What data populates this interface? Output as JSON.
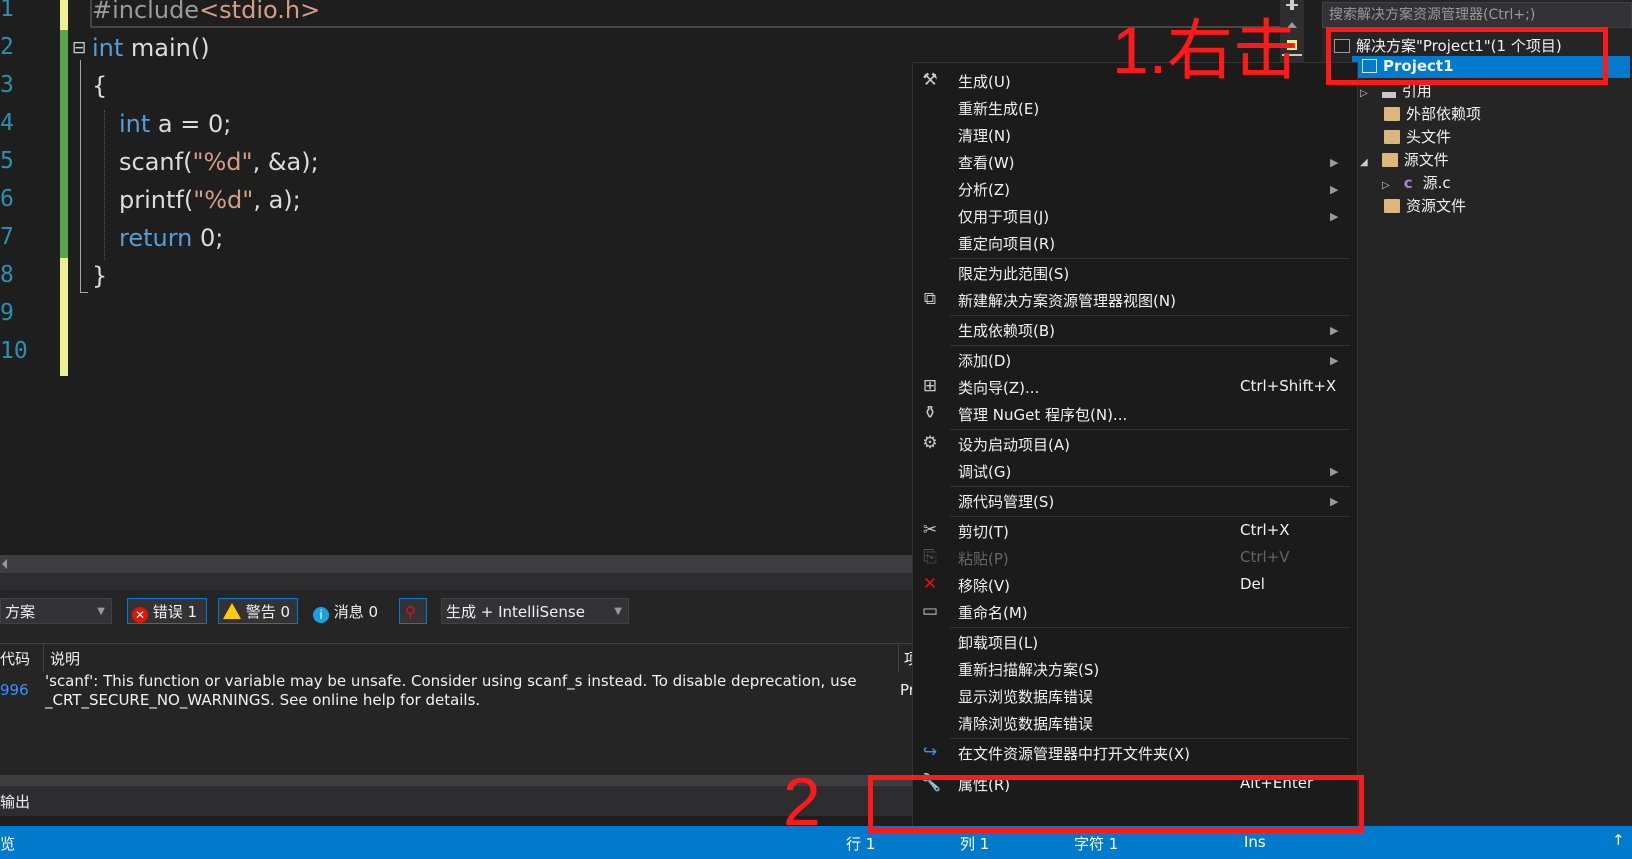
{
  "editor": {
    "line_numbers": [
      "1",
      "2",
      "3",
      "4",
      "5",
      "6",
      "7",
      "8",
      "9",
      "10"
    ],
    "lines": {
      "l1a": "#include",
      "l1b": "<stdio.h>",
      "l2a": "int",
      "l2b": " main()",
      "l3": "{",
      "l4a": "int",
      "l4b": " a = 0;",
      "l5a": "scanf(",
      "l5b": "\"%d\"",
      "l5c": ", &a);",
      "l6a": "printf(",
      "l6b": "\"%d\"",
      "l6c": ", a);",
      "l7a": "return",
      "l7b": " 0;",
      "l8": "}"
    },
    "collapse_glyph": "⊟"
  },
  "error_list": {
    "scope_combo": "方案",
    "errors_btn": "错误 1",
    "warnings_btn": "警告 0",
    "messages_btn": "消息 0",
    "build_combo": "生成 + IntelliSense",
    "col_code": "代码",
    "col_desc": "说明",
    "col_proj": "项",
    "row_code": "996",
    "row_desc_1": "'scanf': This function or variable may be unsafe. Consider using scanf_s instead. To disable deprecation, use",
    "row_desc_2": "_CRT_SECURE_NO_WARNINGS. See online help for details.",
    "row_proj": "Pr",
    "output_tab": "输出"
  },
  "solution_explorer": {
    "search_placeholder": "搜索解决方案资源管理器(Ctrl+;)",
    "solution": "解决方案\"Project1\"(1 个项目)",
    "project": "Project1",
    "references": "引用",
    "external_deps": "外部依赖项",
    "header_files": "头文件",
    "source_files": "源文件",
    "source_c": "源.c",
    "resource_files": "资源文件"
  },
  "context_menu": {
    "build": "生成(U)",
    "rebuild": "重新生成(E)",
    "clean": "清理(N)",
    "view": "查看(W)",
    "analyze": "分析(Z)",
    "project_only": "仅用于项目(J)",
    "retarget": "重定向项目(R)",
    "scope_to_this": "限定为此范围(S)",
    "new_sol_view": "新建解决方案资源管理器视图(N)",
    "build_deps": "生成依赖项(B)",
    "add": "添加(D)",
    "class_wizard": "类向导(Z)...",
    "class_wizard_sc": "Ctrl+Shift+X",
    "nuget": "管理 NuGet 程序包(N)...",
    "set_startup": "设为启动项目(A)",
    "debug": "调试(G)",
    "source_control": "源代码管理(S)",
    "cut": "剪切(T)",
    "cut_sc": "Ctrl+X",
    "paste": "粘贴(P)",
    "paste_sc": "Ctrl+V",
    "remove": "移除(V)",
    "remove_sc": "Del",
    "rename": "重命名(M)",
    "unload": "卸载项目(L)",
    "rescan": "重新扫描解决方案(S)",
    "show_browse_errors": "显示浏览数据库错误",
    "clear_browse_errors": "清除浏览数据库错误",
    "open_in_explorer": "在文件资源管理器中打开文件夹(X)",
    "properties": "属性(R)",
    "properties_sc": "Alt+Enter"
  },
  "status_bar": {
    "left": "览",
    "row": "行 1",
    "col": "列 1",
    "char": "字符 1",
    "ins": "Ins"
  },
  "annotations": {
    "step1": "1.右击",
    "step2": "2"
  },
  "colors": {
    "accent": "#007acc",
    "annotation_red": "#ff1a1a",
    "keyword": "#569cd6",
    "string": "#d69d85"
  }
}
